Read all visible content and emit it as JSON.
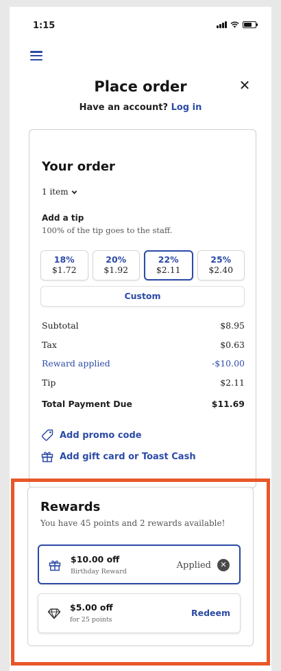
{
  "status_bar": {
    "time": "1:15"
  },
  "header": {
    "title": "Place order",
    "account_prompt": "Have an account?",
    "login_label": "Log in"
  },
  "order": {
    "title": "Your order",
    "items_label": "1 item",
    "tip_title": "Add a tip",
    "tip_subtitle": "100% of the tip goes to the staff.",
    "tip_options": [
      {
        "percent": "18%",
        "amount": "$1.72"
      },
      {
        "percent": "20%",
        "amount": "$1.92"
      },
      {
        "percent": "22%",
        "amount": "$2.11"
      },
      {
        "percent": "25%",
        "amount": "$2.40"
      }
    ],
    "custom_label": "Custom",
    "summary": {
      "subtotal_label": "Subtotal",
      "subtotal_value": "$8.95",
      "tax_label": "Tax",
      "tax_value": "$0.63",
      "reward_label": "Reward applied",
      "reward_value": "-$10.00",
      "tip_label": "Tip",
      "tip_value": "$2.11",
      "total_label": "Total Payment Due",
      "total_value": "$11.69"
    },
    "promo_label": "Add promo code",
    "gift_label": "Add gift card or Toast Cash"
  },
  "rewards": {
    "title": "Rewards",
    "subtitle": "You have 45 points and 2 rewards available!",
    "items": [
      {
        "name": "$10.00 off",
        "note": "Birthday Reward",
        "status": "Applied",
        "icon": "gift-icon"
      },
      {
        "name": "$5.00 off",
        "note": "for 25 points",
        "action": "Redeem",
        "icon": "diamond-icon"
      }
    ]
  },
  "colors": {
    "accent": "#2b4aa6",
    "highlight_border": "#e8572a",
    "background": "#e8e8e8"
  },
  "icons": [
    "menu-icon",
    "close-icon",
    "chevron-down-icon",
    "tag-icon",
    "gift-icon",
    "diamond-icon",
    "remove-icon",
    "signal-icon",
    "wifi-icon",
    "battery-icon"
  ]
}
